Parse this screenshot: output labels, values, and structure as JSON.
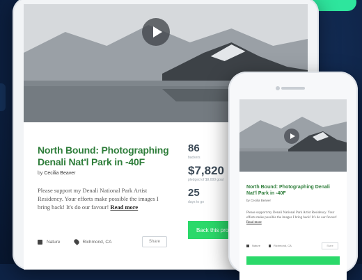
{
  "colors": {
    "accent_green": "#2bd96a",
    "title_green": "#2e7d3a",
    "background_navy": "#0e2346"
  },
  "tablet": {
    "title": "North Bound: Photographing Denali Nat'l Park in -40F",
    "byline_prefix": "by",
    "author": "Cecilia Beaver",
    "description": "Please support my Denali National Park Artist Residency. Your efforts make possible the images I bring back! It's do our favour!",
    "read_more": "Read more",
    "category": "Nature",
    "location": "Richmond, CA",
    "share_label": "Share",
    "stats": {
      "backers": "86",
      "backers_label": "backers",
      "pledged": "$7,820",
      "pledged_label": "pledged of $9,000 goal",
      "days": "25",
      "days_label": "days to go"
    },
    "back_button": "Back this project",
    "play_icon": "play-icon"
  },
  "phone": {
    "title": "North Bound: Photographing Denali Nat'l Park in -40F",
    "byline_prefix": "by",
    "author": "Cecilia Beaver",
    "description": "Please support my Denali National Park Artist Residency. Your efforts make possible the images I bring back! It's do our favour!",
    "read_more": "Read more",
    "category": "Nature",
    "location": "Richmond, CA",
    "share_label": "Share",
    "play_icon": "play-icon"
  }
}
